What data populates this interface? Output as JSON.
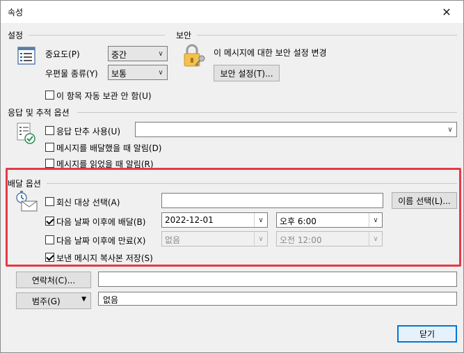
{
  "window": {
    "title": "속성",
    "close_glyph": "✕"
  },
  "settings": {
    "section_label": "설정",
    "importance_label": "중요도(P)",
    "importance_value": "중간",
    "sensitivity_label": "우편물 종류(Y)",
    "sensitivity_value": "보통",
    "no_autoarchive_label": "이 항목 자동 보관 안 함(U)",
    "no_autoarchive_checked": false
  },
  "security": {
    "section_label": "보안",
    "description": "이 메시지에 대한 보안 설정 변경",
    "button_label": "보안 설정(T)..."
  },
  "voting": {
    "section_label": "응답 및 추적 옵션",
    "use_voting_label": "응답 단추 사용(U)",
    "use_voting_checked": false,
    "voting_value": "",
    "delivery_receipt_label": "메시지를 배달했을 때 알림(D)",
    "delivery_receipt_checked": false,
    "read_receipt_label": "메시지를 읽었을 때 알림(R)",
    "read_receipt_checked": false
  },
  "delivery": {
    "section_label": "배달 옵션",
    "reply_to_label": "회신 대상 선택(A)",
    "reply_to_checked": false,
    "reply_to_value": "",
    "select_names_label": "이름 선택(L)...",
    "defer_label": "다음 날짜 이후에 배달(B)",
    "defer_checked": true,
    "defer_date": "2022-12-01",
    "defer_time": "오후 6:00",
    "expire_label": "다음 날짜 이후에 만료(X)",
    "expire_checked": false,
    "expire_date": "없음",
    "expire_time": "오전 12:00",
    "save_copy_label": "보낸 메시지 복사본 저장(S)",
    "save_copy_checked": true
  },
  "contacts": {
    "button_label": "연락처(C)...",
    "value": ""
  },
  "categories": {
    "button_label": "범주(G)",
    "arrow": "▼",
    "value": "없음"
  },
  "footer": {
    "close_label": "닫기"
  },
  "colors": {
    "highlight": "#e63946",
    "accent": "#0078d7"
  }
}
